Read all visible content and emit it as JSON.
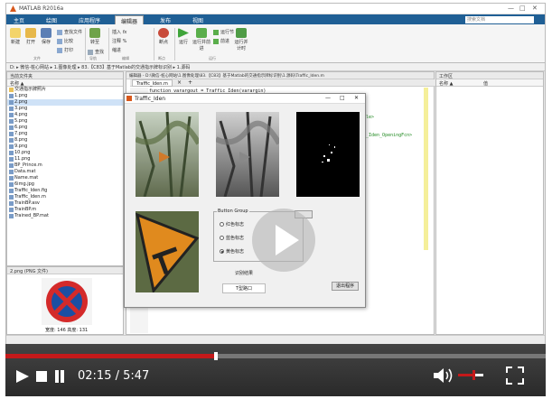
{
  "window": {
    "title": "MATLAB R2016a"
  },
  "ribbon_tabs": [
    "主页",
    "绘图",
    "应用程序",
    "编辑器",
    "发布",
    "视图"
  ],
  "search_placeholder": "搜索文档",
  "ribbon": {
    "new": "新建",
    "open": "打开",
    "save": "保存",
    "find_files": "查找文件",
    "compare": "比较",
    "print": "打印",
    "insert": "插入",
    "comment": "注释",
    "indent": "缩进",
    "goto": "转至",
    "find": "查找",
    "breakpoints": "断点",
    "run": "运行",
    "run_and_advance": "运行并前进",
    "run_section": "运行节",
    "advance": "前进",
    "run_and_time": "运行并计时",
    "group_file": "文件",
    "group_navigate": "导航",
    "group_edit": "编辑",
    "group_breakpoints": "断点",
    "group_run": "运行"
  },
  "address": "D: ▸ 微信-桩心网站 ▸ 1.图像处理 ▸ 83.【C83】基于Matlab的交通指示牌标识别 ▸ 1.源码",
  "current_folder": {
    "header": "当前文件夹",
    "col_name": "名称 ▲",
    "folder": "交通指示牌照片",
    "files": [
      "1.png",
      "2.png",
      "3.png",
      "4.png",
      "5.png",
      "6.png",
      "7.png",
      "8.png",
      "9.png",
      "10.png",
      "11.png",
      "BP_Prince.m",
      "Data.mat",
      "Name.mat",
      "6img.jpg",
      "Traffic_Iden.fig",
      "Traffic_Iden.m",
      "TrainBP.asv",
      "TrainBP.m",
      "Trained_BP.mat"
    ],
    "selected_index": 1
  },
  "details": {
    "title": "2.png (PNG 文件)",
    "caption": "宽度: 146 高度: 131"
  },
  "editor": {
    "path": "编辑器 - D:\\微信-桩心网站\\1.图像处理\\83.【C83】基于Matlab的交通指示牌标识别\\1.源码\\Traffic_Iden.m",
    "tab": "Traffic_Iden.m",
    "line1": "function varargout = Traffic_Iden(varargin)",
    "snippet1": "le>",
    "snippet2": "_Iden_OpeningFcn>"
  },
  "workspace": {
    "header": "工作区",
    "col_name": "名称 ▲",
    "col_value": "值"
  },
  "dialog": {
    "title": "Traffic_Iden",
    "group_title": "Button Group",
    "options": [
      "红色标志",
      "蓝色标志",
      "黄色标志"
    ],
    "selected_option": 2,
    "result_label": "识别结果",
    "result_value": "T型路口",
    "exit_button": "退出程序"
  },
  "player": {
    "current_time": "02:15",
    "duration": "5:47",
    "time_display": "02:15 / 5:47",
    "progress": 0.389,
    "volume": 0.6
  },
  "colors": {
    "matlab_blue": "#1f5f95",
    "progress_red": "#c4191a",
    "sign_orange": "#e08a1e"
  }
}
